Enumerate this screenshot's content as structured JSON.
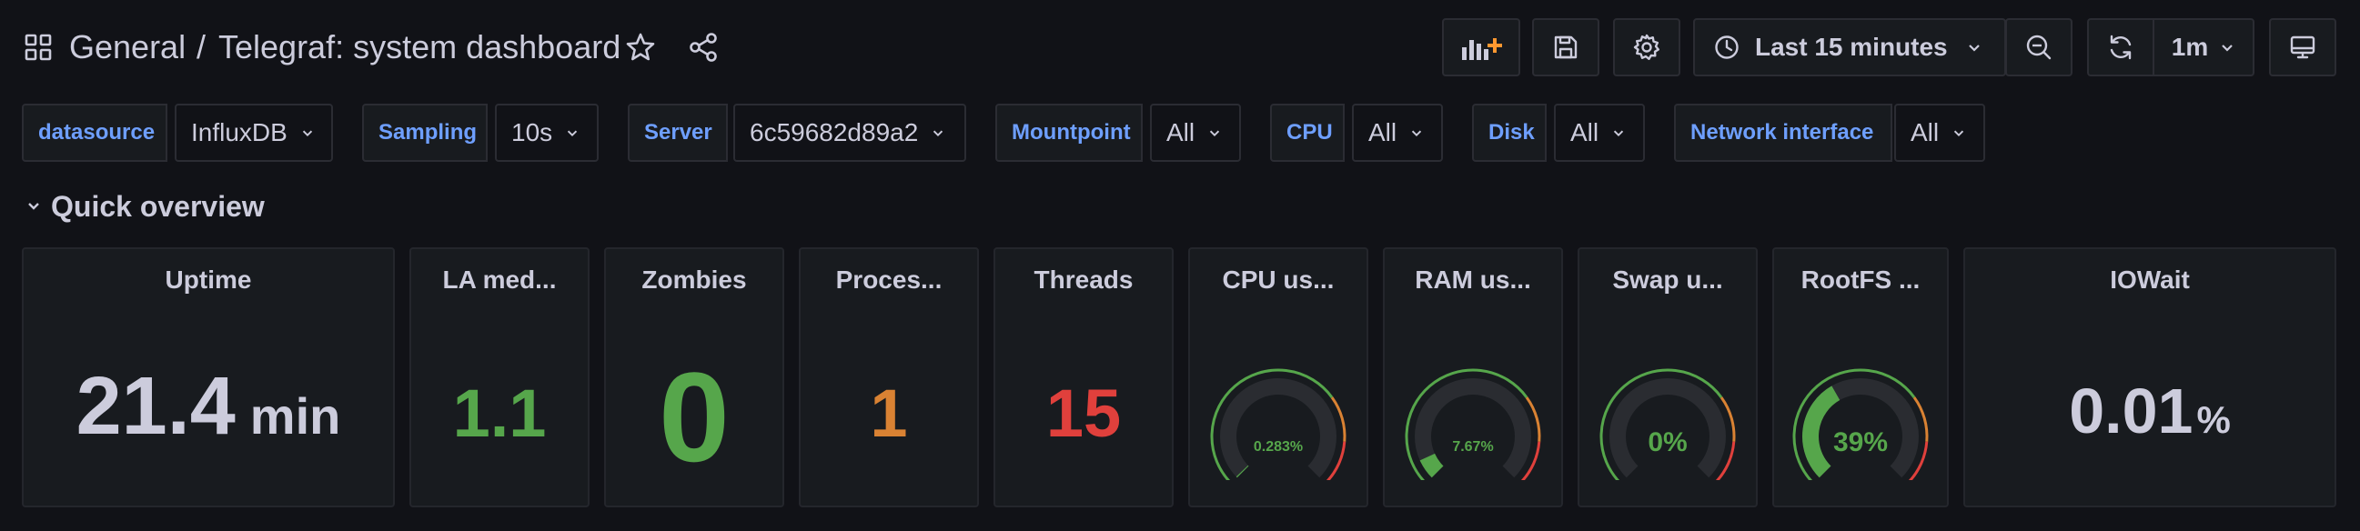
{
  "header": {
    "folder": "General",
    "separator": "/",
    "title": "Telegraf: system dashboard"
  },
  "toolbar": {
    "add_panel_icon": "add-panel-icon",
    "save_icon": "save-icon",
    "settings_icon": "gear-icon",
    "time_range": "Last 15 minutes",
    "zoom_icon": "zoom-out-icon",
    "refresh_icon": "refresh-icon",
    "refresh_interval": "1m",
    "tv_icon": "tv-mode-icon"
  },
  "variables": {
    "datasource": {
      "label": "datasource",
      "value": "InfluxDB"
    },
    "sampling": {
      "label": "Sampling",
      "value": "10s"
    },
    "server": {
      "label": "Server",
      "value": "6c59682d89a2"
    },
    "mountpoint": {
      "label": "Mountpoint",
      "value": "All"
    },
    "cpu": {
      "label": "CPU",
      "value": "All"
    },
    "disk": {
      "label": "Disk",
      "value": "All"
    },
    "netif": {
      "label": "Network interface",
      "value": "All"
    }
  },
  "row": {
    "title": "Quick overview"
  },
  "panels": {
    "uptime": {
      "title": "Uptime",
      "value": "21.4",
      "unit": "min",
      "color": "#ccccdc"
    },
    "la": {
      "title": "LA med...",
      "value": "1.1",
      "color": "#56a64b"
    },
    "zombies": {
      "title": "Zombies",
      "value": "0",
      "color": "#56a64b"
    },
    "processes": {
      "title": "Proces...",
      "value": "1",
      "color": "#d98233"
    },
    "threads": {
      "title": "Threads",
      "value": "15",
      "color": "#e0403c"
    },
    "cpu": {
      "title": "CPU us...",
      "value": "0.283%",
      "percent": 0.283,
      "color": "#56a64b"
    },
    "ram": {
      "title": "RAM us...",
      "value": "7.67%",
      "percent": 7.67,
      "color": "#56a64b"
    },
    "swap": {
      "title": "Swap u...",
      "value": "0%",
      "percent": 0,
      "color": "#56a64b"
    },
    "rootfs": {
      "title": "RootFS ...",
      "value": "39%",
      "percent": 39,
      "color": "#56a64b"
    },
    "iowait": {
      "title": "IOWait",
      "value": "0.01",
      "unit": "%",
      "color": "#ccccdc"
    }
  },
  "colors": {
    "accent_blue": "#6e9fff",
    "green": "#56a64b",
    "orange": "#d98233",
    "red": "#e0403c"
  }
}
